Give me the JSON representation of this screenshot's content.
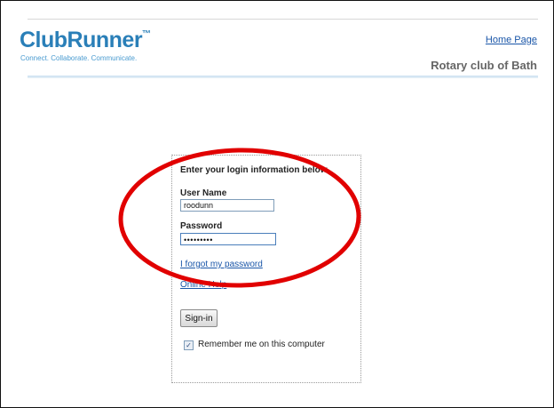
{
  "header": {
    "logo_text": "ClubRunner",
    "logo_tm": "™",
    "tagline": "Connect. Collaborate. Communicate.",
    "home_link": "Home Page",
    "club_name": "Rotary club of Bath"
  },
  "login": {
    "intro": "Enter your login information below",
    "username_label": "User Name",
    "username_value": "roodunn",
    "password_label": "Password",
    "password_value": "•••••••••",
    "forgot_link": "I forgot my password",
    "help_link": "Online Help",
    "signin_label": "Sign-in",
    "remember_label": "Remember me on this computer",
    "remember_checked": true
  },
  "annotation": {
    "color": "#e10000"
  }
}
